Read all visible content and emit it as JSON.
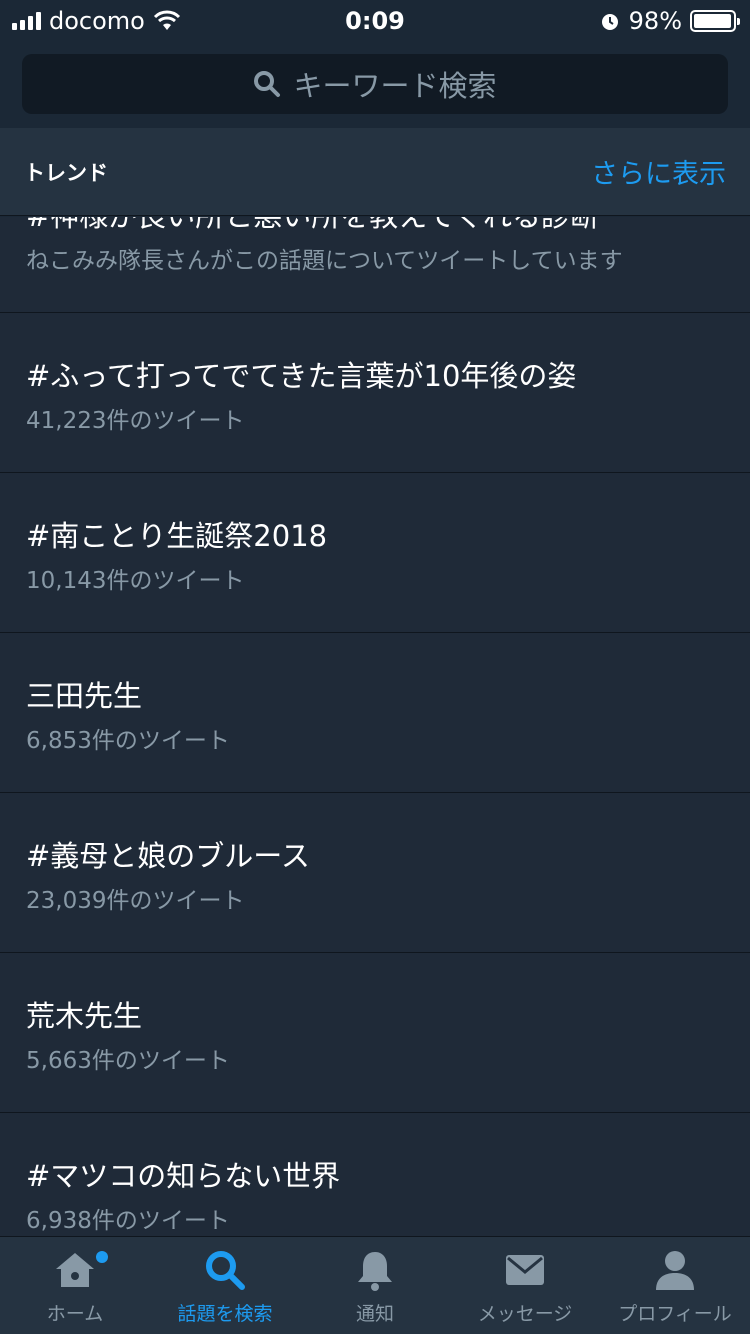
{
  "status_bar": {
    "carrier": "docomo",
    "time": "0:09",
    "battery": "98%",
    "battery_level": 0.98
  },
  "search": {
    "placeholder": "キーワード検索",
    "icon": "search-icon"
  },
  "trends": {
    "title": "トレンド",
    "show_more": "さらに表示",
    "items": [
      {
        "name": "#神様が良い所と悪い所を教えてくれる診断",
        "meta": "ねこみみ隊長さんがこの話題についてツイートしています"
      },
      {
        "name": "#ふって打ってでてきた言葉が10年後の姿",
        "meta": "41,223件のツイート"
      },
      {
        "name": "#南ことり生誕祭2018",
        "meta": "10,143件のツイート"
      },
      {
        "name": "三田先生",
        "meta": "6,853件のツイート"
      },
      {
        "name": "#義母と娘のブルース",
        "meta": "23,039件のツイート"
      },
      {
        "name": "荒木先生",
        "meta": "5,663件のツイート"
      },
      {
        "name": "#マツコの知らない世界",
        "meta": "6,938件のツイート"
      }
    ]
  },
  "tab_bar": {
    "tabs": [
      {
        "label": "ホーム",
        "icon": "home-icon"
      },
      {
        "label": "話題を検索",
        "icon": "search-icon",
        "active": true
      },
      {
        "label": "通知",
        "icon": "bell-icon"
      },
      {
        "label": "メッセージ",
        "icon": "mail-icon"
      },
      {
        "label": "プロフィール",
        "icon": "person-icon"
      }
    ]
  },
  "colors": {
    "accent": "#1d9bf0",
    "background": "#1f2a38",
    "secondary_text": "#8899a6"
  }
}
